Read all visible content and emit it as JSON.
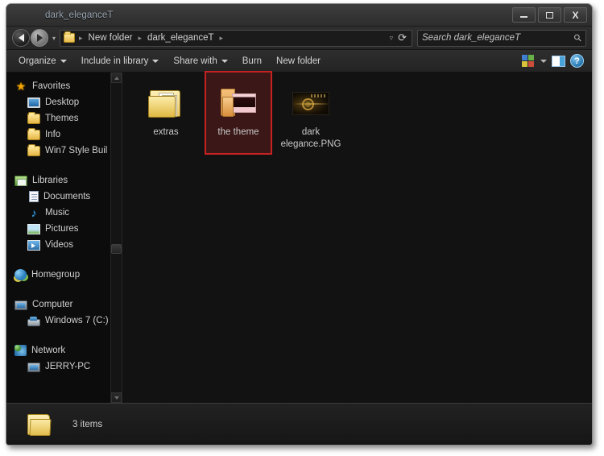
{
  "window": {
    "title": "dark_eleganceT",
    "buttons": {
      "minimize": "minimize-button",
      "maximize": "maximize-button",
      "close": "X"
    }
  },
  "address_bar": {
    "back": "back-button",
    "forward": "forward-button",
    "recent_pages": "▾",
    "breadcrumbs": [
      "New folder",
      "dark_eleganceT"
    ],
    "separator": "▸",
    "dropdown": "▿",
    "refresh": "⟳"
  },
  "search": {
    "placeholder": "Search dark_eleganceT",
    "icon": "search-icon"
  },
  "toolbar": {
    "items": [
      {
        "label": "Organize",
        "has_caret": true
      },
      {
        "label": "Include in library",
        "has_caret": true
      },
      {
        "label": "Share with",
        "has_caret": true
      },
      {
        "label": "Burn",
        "has_caret": false
      },
      {
        "label": "New folder",
        "has_caret": false
      }
    ],
    "right": {
      "view_icon": "change-view-icon",
      "view_caret": "▾",
      "preview_pane": "preview-pane-icon",
      "help": "?"
    }
  },
  "sidebar": {
    "groups": [
      {
        "header": {
          "label": "Favorites",
          "icon": "star-icon"
        },
        "items": [
          {
            "label": "Desktop",
            "icon": "desktop-icon"
          },
          {
            "label": "Themes",
            "icon": "folder-icon"
          },
          {
            "label": "Info",
            "icon": "folder-icon"
          },
          {
            "label": "Win7 Style Buil",
            "icon": "folder-icon"
          }
        ]
      },
      {
        "header": {
          "label": "Libraries",
          "icon": "libraries-icon"
        },
        "items": [
          {
            "label": "Documents",
            "icon": "document-icon"
          },
          {
            "label": "Music",
            "icon": "music-note-icon"
          },
          {
            "label": "Pictures",
            "icon": "picture-icon"
          },
          {
            "label": "Videos",
            "icon": "video-icon"
          }
        ]
      },
      {
        "header": {
          "label": "Homegroup",
          "icon": "homegroup-icon"
        },
        "items": []
      },
      {
        "header": {
          "label": "Computer",
          "icon": "computer-icon"
        },
        "items": [
          {
            "label": "Windows 7 (C:)",
            "icon": "hard-drive-icon"
          }
        ]
      },
      {
        "header": {
          "label": "Network",
          "icon": "network-icon"
        },
        "items": [
          {
            "label": "JERRY-PC",
            "icon": "computer-icon"
          }
        ]
      }
    ]
  },
  "content": {
    "files": [
      {
        "name": "extras",
        "type": "folder",
        "selected": false
      },
      {
        "name": "the theme",
        "type": "folder",
        "selected": true
      },
      {
        "name": "dark elegance.PNG",
        "type": "image",
        "selected": false
      }
    ]
  },
  "status": {
    "text": "3 items",
    "icon": "folder-icon"
  },
  "colors": {
    "window_bg": "#2b2b2b",
    "content_bg": "#121212",
    "sidebar_bg": "#0c0c0c",
    "text": "#cfcfcf",
    "title_text": "#9ba7b4",
    "selection_bg": "#3b1717",
    "selection_border": "#c62222",
    "folder_yellow": "#e6b745"
  }
}
